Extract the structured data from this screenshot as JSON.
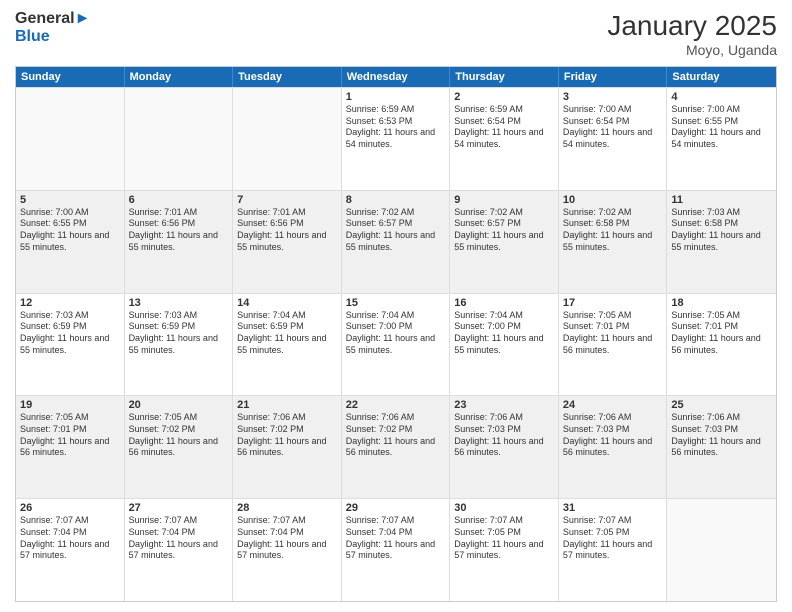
{
  "header": {
    "logo_line1": "General",
    "logo_line2": "Blue",
    "month_year": "January 2025",
    "location": "Moyo, Uganda"
  },
  "days_of_week": [
    "Sunday",
    "Monday",
    "Tuesday",
    "Wednesday",
    "Thursday",
    "Friday",
    "Saturday"
  ],
  "weeks": [
    [
      {
        "day": "",
        "empty": true
      },
      {
        "day": "",
        "empty": true
      },
      {
        "day": "",
        "empty": true
      },
      {
        "day": "1",
        "sunrise": "6:59 AM",
        "sunset": "6:53 PM",
        "daylight": "11 hours and 54 minutes."
      },
      {
        "day": "2",
        "sunrise": "6:59 AM",
        "sunset": "6:54 PM",
        "daylight": "11 hours and 54 minutes."
      },
      {
        "day": "3",
        "sunrise": "7:00 AM",
        "sunset": "6:54 PM",
        "daylight": "11 hours and 54 minutes."
      },
      {
        "day": "4",
        "sunrise": "7:00 AM",
        "sunset": "6:55 PM",
        "daylight": "11 hours and 54 minutes."
      }
    ],
    [
      {
        "day": "5",
        "sunrise": "7:00 AM",
        "sunset": "6:55 PM",
        "daylight": "11 hours and 55 minutes."
      },
      {
        "day": "6",
        "sunrise": "7:01 AM",
        "sunset": "6:56 PM",
        "daylight": "11 hours and 55 minutes."
      },
      {
        "day": "7",
        "sunrise": "7:01 AM",
        "sunset": "6:56 PM",
        "daylight": "11 hours and 55 minutes."
      },
      {
        "day": "8",
        "sunrise": "7:02 AM",
        "sunset": "6:57 PM",
        "daylight": "11 hours and 55 minutes."
      },
      {
        "day": "9",
        "sunrise": "7:02 AM",
        "sunset": "6:57 PM",
        "daylight": "11 hours and 55 minutes."
      },
      {
        "day": "10",
        "sunrise": "7:02 AM",
        "sunset": "6:58 PM",
        "daylight": "11 hours and 55 minutes."
      },
      {
        "day": "11",
        "sunrise": "7:03 AM",
        "sunset": "6:58 PM",
        "daylight": "11 hours and 55 minutes."
      }
    ],
    [
      {
        "day": "12",
        "sunrise": "7:03 AM",
        "sunset": "6:59 PM",
        "daylight": "11 hours and 55 minutes."
      },
      {
        "day": "13",
        "sunrise": "7:03 AM",
        "sunset": "6:59 PM",
        "daylight": "11 hours and 55 minutes."
      },
      {
        "day": "14",
        "sunrise": "7:04 AM",
        "sunset": "6:59 PM",
        "daylight": "11 hours and 55 minutes."
      },
      {
        "day": "15",
        "sunrise": "7:04 AM",
        "sunset": "7:00 PM",
        "daylight": "11 hours and 55 minutes."
      },
      {
        "day": "16",
        "sunrise": "7:04 AM",
        "sunset": "7:00 PM",
        "daylight": "11 hours and 55 minutes."
      },
      {
        "day": "17",
        "sunrise": "7:05 AM",
        "sunset": "7:01 PM",
        "daylight": "11 hours and 56 minutes."
      },
      {
        "day": "18",
        "sunrise": "7:05 AM",
        "sunset": "7:01 PM",
        "daylight": "11 hours and 56 minutes."
      }
    ],
    [
      {
        "day": "19",
        "sunrise": "7:05 AM",
        "sunset": "7:01 PM",
        "daylight": "11 hours and 56 minutes."
      },
      {
        "day": "20",
        "sunrise": "7:05 AM",
        "sunset": "7:02 PM",
        "daylight": "11 hours and 56 minutes."
      },
      {
        "day": "21",
        "sunrise": "7:06 AM",
        "sunset": "7:02 PM",
        "daylight": "11 hours and 56 minutes."
      },
      {
        "day": "22",
        "sunrise": "7:06 AM",
        "sunset": "7:02 PM",
        "daylight": "11 hours and 56 minutes."
      },
      {
        "day": "23",
        "sunrise": "7:06 AM",
        "sunset": "7:03 PM",
        "daylight": "11 hours and 56 minutes."
      },
      {
        "day": "24",
        "sunrise": "7:06 AM",
        "sunset": "7:03 PM",
        "daylight": "11 hours and 56 minutes."
      },
      {
        "day": "25",
        "sunrise": "7:06 AM",
        "sunset": "7:03 PM",
        "daylight": "11 hours and 56 minutes."
      }
    ],
    [
      {
        "day": "26",
        "sunrise": "7:07 AM",
        "sunset": "7:04 PM",
        "daylight": "11 hours and 57 minutes."
      },
      {
        "day": "27",
        "sunrise": "7:07 AM",
        "sunset": "7:04 PM",
        "daylight": "11 hours and 57 minutes."
      },
      {
        "day": "28",
        "sunrise": "7:07 AM",
        "sunset": "7:04 PM",
        "daylight": "11 hours and 57 minutes."
      },
      {
        "day": "29",
        "sunrise": "7:07 AM",
        "sunset": "7:04 PM",
        "daylight": "11 hours and 57 minutes."
      },
      {
        "day": "30",
        "sunrise": "7:07 AM",
        "sunset": "7:05 PM",
        "daylight": "11 hours and 57 minutes."
      },
      {
        "day": "31",
        "sunrise": "7:07 AM",
        "sunset": "7:05 PM",
        "daylight": "11 hours and 57 minutes."
      },
      {
        "day": "",
        "empty": true
      }
    ]
  ],
  "labels": {
    "sunrise": "Sunrise:",
    "sunset": "Sunset:",
    "daylight": "Daylight:"
  }
}
